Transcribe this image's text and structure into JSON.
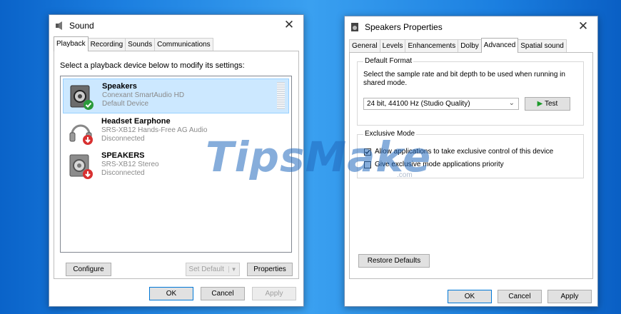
{
  "watermark": {
    "brand": "TipsMake",
    ".com": ".com"
  },
  "sound_dialog": {
    "title": "Sound",
    "tabs": [
      "Playback",
      "Recording",
      "Sounds",
      "Communications"
    ],
    "instruction": "Select a playback device below to modify its settings:",
    "devices": [
      {
        "name": "Speakers",
        "detail": "Conexant SmartAudio HD",
        "status": "Default Device"
      },
      {
        "name": "Headset Earphone",
        "detail": "SRS-XB12 Hands-Free AG Audio",
        "status": "Disconnected"
      },
      {
        "name": "SPEAKERS",
        "detail": "SRS-XB12 Stereo",
        "status": "Disconnected"
      }
    ],
    "buttons": {
      "configure": "Configure",
      "set_default": "Set Default",
      "set_default_arrow": "▼",
      "properties": "Properties",
      "ok": "OK",
      "cancel": "Cancel",
      "apply": "Apply"
    }
  },
  "props_dialog": {
    "title": "Speakers Properties",
    "tabs": [
      "General",
      "Levels",
      "Enhancements",
      "Dolby",
      "Advanced",
      "Spatial sound"
    ],
    "default_format": {
      "legend": "Default Format",
      "description": "Select the sample rate and bit depth to be used when running in shared mode.",
      "selected": "24 bit, 44100 Hz (Studio Quality)",
      "test": "Test"
    },
    "exclusive_mode": {
      "legend": "Exclusive Mode",
      "allow_label": "Allow applications to take exclusive control of this device",
      "priority_label": "Give exclusive mode applications priority"
    },
    "buttons": {
      "restore": "Restore Defaults",
      "ok": "OK",
      "cancel": "Cancel",
      "apply": "Apply"
    }
  }
}
